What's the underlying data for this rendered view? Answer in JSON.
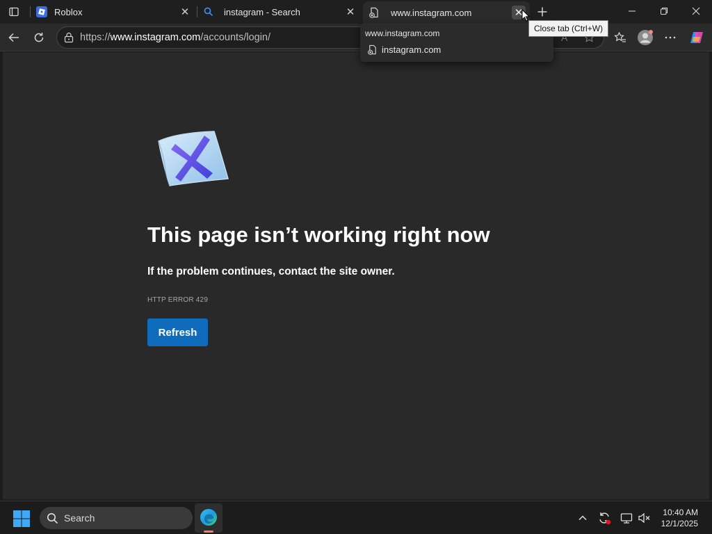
{
  "tabs": [
    {
      "title": "Roblox",
      "icon": "roblox-icon"
    },
    {
      "title": "instagram - Search",
      "icon": "search-icon"
    },
    {
      "title": "www.instagram.com",
      "icon": "error-page-icon",
      "active": true
    }
  ],
  "tooltip": {
    "close_tab": "Close tab (Ctrl+W)"
  },
  "hover_card": {
    "domain": "www.instagram.com",
    "item": "instagram.com"
  },
  "address_bar": {
    "url_prefix": "https://",
    "url_host": "www.instagram.com",
    "url_path": "/accounts/login/"
  },
  "error_page": {
    "title": "This page isn’t working right now",
    "subtitle": "If the problem continues, contact the site owner.",
    "code": "HTTP ERROR 429",
    "refresh_label": "Refresh"
  },
  "taskbar": {
    "search_placeholder": "Search",
    "time": "10:40 AM",
    "date": "12/1/2025"
  },
  "colors": {
    "accent": "#0f6cbd",
    "page_bg": "#292929",
    "tabstrip_bg": "#1f1f1f"
  }
}
